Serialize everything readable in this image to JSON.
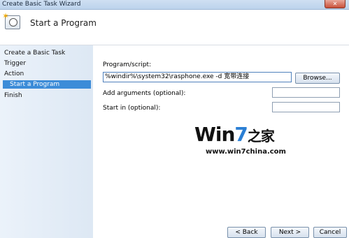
{
  "window": {
    "title": "Create Basic Task Wizard",
    "close_glyph": "✕"
  },
  "header": {
    "title": "Start a Program"
  },
  "sidebar": {
    "items": [
      {
        "label": "Create a Basic Task"
      },
      {
        "label": "Trigger"
      },
      {
        "label": "Action"
      },
      {
        "label": "Start a Program"
      },
      {
        "label": "Finish"
      }
    ]
  },
  "form": {
    "program_label": "Program/script:",
    "program_value": "%windir%\\system32\\rasphone.exe -d 宽带连接",
    "browse_label": "Browse...",
    "args_label": "Add arguments (optional):",
    "args_value": "",
    "start_in_label": "Start in (optional):",
    "start_in_value": ""
  },
  "watermark": {
    "brand_prefix": "Win",
    "brand_seven": "7",
    "brand_suffix": "之家",
    "url": "www.win7china.com"
  },
  "footer": {
    "back_label": "< Back",
    "next_label": "Next >",
    "cancel_label": "Cancel"
  }
}
